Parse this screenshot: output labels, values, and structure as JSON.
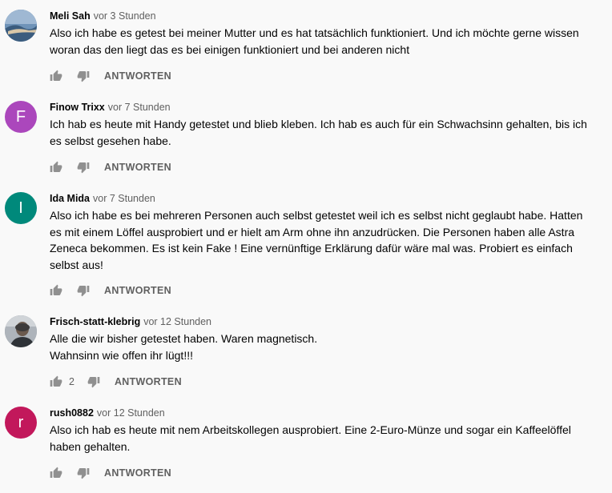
{
  "comments": [
    {
      "author": "Meli Sah",
      "time": "vor 3 Stunden",
      "avatar_letter": "",
      "avatar_color": "#5b7fa3",
      "lines": [
        "Also ich habe es getest bei meiner Mutter und es hat tatsächlich funktioniert. Und ich möchte gerne wissen",
        "woran das den liegt das es bei einigen funktioniert und bei anderen nicht"
      ],
      "likes": "",
      "reply_label": "ANTWORTEN"
    },
    {
      "author": "Finow Trixx",
      "time": "vor 7 Stunden",
      "avatar_letter": "F",
      "avatar_color": "#ab47bc",
      "lines": [
        "Ich hab es heute mit Handy getestet und blieb kleben. Ich hab es auch für ein Schwachsinn gehalten, bis ich",
        "es selbst gesehen habe."
      ],
      "likes": "",
      "reply_label": "ANTWORTEN"
    },
    {
      "author": "Ida Mida",
      "time": "vor 7 Stunden",
      "avatar_letter": "I",
      "avatar_color": "#00897b",
      "lines": [
        "Also ich habe es bei mehreren Personen auch selbst getestet weil ich es selbst nicht geglaubt habe. Hatten",
        "es mit einem Löffel ausprobiert und er hielt am Arm ohne ihn anzudrücken. Die Personen haben alle Astra",
        "Zeneca bekommen. Es ist kein Fake ! Eine vernünftige Erklärung dafür wäre mal was. Probiert es einfach",
        "selbst aus!"
      ],
      "likes": "",
      "reply_label": "ANTWORTEN"
    },
    {
      "author": "Frisch-statt-klebrig",
      "time": "vor 12 Stunden",
      "avatar_letter": "",
      "avatar_color": "#7a8088",
      "lines": [
        "Alle die wir bisher getestet haben. Waren magnetisch.",
        "Wahnsinn wie offen ihr lügt!!!"
      ],
      "likes": "2",
      "reply_label": "ANTWORTEN"
    },
    {
      "author": "rush0882",
      "time": "vor 12 Stunden",
      "avatar_letter": "r",
      "avatar_color": "#c2185b",
      "lines": [
        "Also ich hab es heute mit nem Arbeitskollegen ausprobiert. Eine 2-Euro-Münze und sogar ein Kaffeelöffel",
        "haben gehalten."
      ],
      "likes": "",
      "reply_label": "ANTWORTEN"
    }
  ]
}
